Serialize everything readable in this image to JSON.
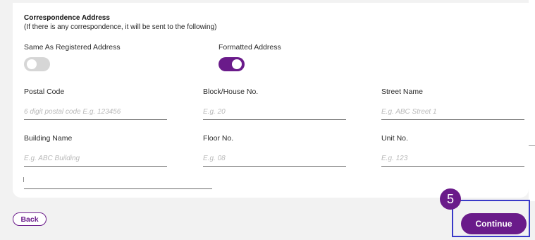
{
  "section": {
    "title": "Correspondence Address",
    "subtitle": "(If there is any correspondence, it will be sent to the following)"
  },
  "toggles": {
    "same_as_registered": {
      "label": "Same As Registered Address",
      "on": false
    },
    "formatted_address": {
      "label": "Formatted Address",
      "on": true
    }
  },
  "fields": {
    "postal_code": {
      "label": "Postal Code",
      "placeholder": "6 digit postal code E.g. 123456",
      "value": ""
    },
    "block_house": {
      "label": "Block/House No.",
      "placeholder": "E.g. 20",
      "value": ""
    },
    "street_name": {
      "label": "Street Name",
      "placeholder": "E.g. ABC Street 1",
      "value": ""
    },
    "building_name": {
      "label": "Building Name",
      "placeholder": "E.g. ABC Building",
      "value": ""
    },
    "floor_no": {
      "label": "Floor No.",
      "placeholder": "E.g. 08",
      "value": ""
    },
    "unit_no": {
      "label": "Unit No.",
      "placeholder": "E.g. 123",
      "value": ""
    },
    "extra_line": {
      "value": ""
    }
  },
  "actions": {
    "back_label": "Back",
    "continue_label": "Continue",
    "step_number": "5"
  },
  "colors": {
    "accent": "#6a1b8a",
    "highlight": "#3a3ac8",
    "toggle_off": "#d6d6d6"
  }
}
